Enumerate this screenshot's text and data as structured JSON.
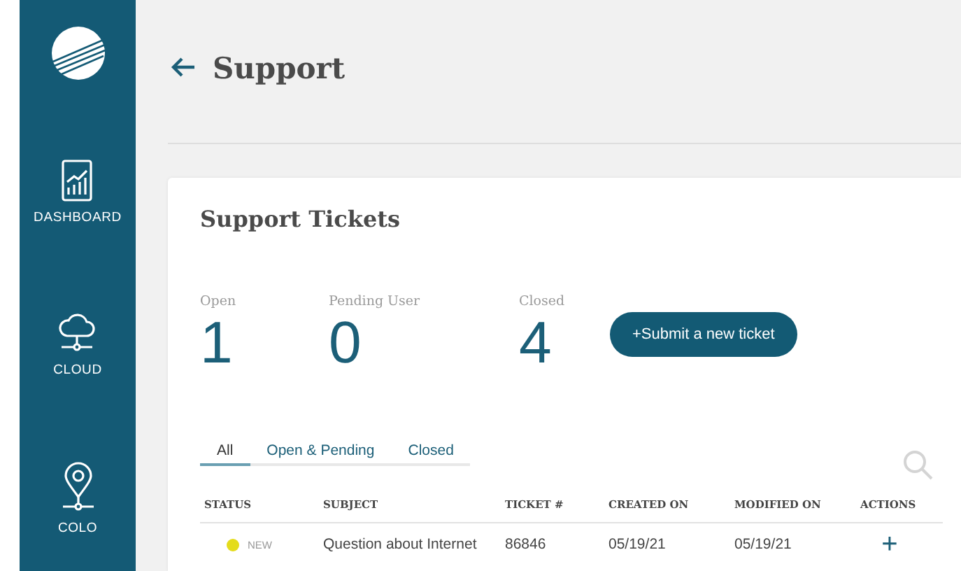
{
  "sidebar": {
    "items": [
      {
        "label": "DASHBOARD",
        "kind": "dashboard"
      },
      {
        "label": "CLOUD",
        "kind": "cloud"
      },
      {
        "label": "COLO",
        "kind": "colo"
      }
    ]
  },
  "page_title": "Support",
  "card": {
    "title": "Support Tickets",
    "stats": [
      {
        "label": "Open",
        "value": "1"
      },
      {
        "label": "Pending User",
        "value": "0"
      },
      {
        "label": "Closed",
        "value": "4"
      }
    ],
    "submit_button": "+Submit a new ticket",
    "tabs": [
      {
        "label": "All",
        "selected": true
      },
      {
        "label": "Open & Pending",
        "selected": false
      },
      {
        "label": "Closed",
        "selected": false
      }
    ],
    "table": {
      "columns": [
        "STATUS",
        "SUBJECT",
        "TICKET #",
        "CREATED ON",
        "MODIFIED ON",
        "ACTIONS"
      ],
      "rows": [
        {
          "status": "NEW",
          "color": "#e4dc1c",
          "subject": "Question about Internet",
          "ticket": "86846",
          "created": "05/19/21",
          "modified": "05/19/21",
          "action": "+"
        }
      ]
    }
  }
}
